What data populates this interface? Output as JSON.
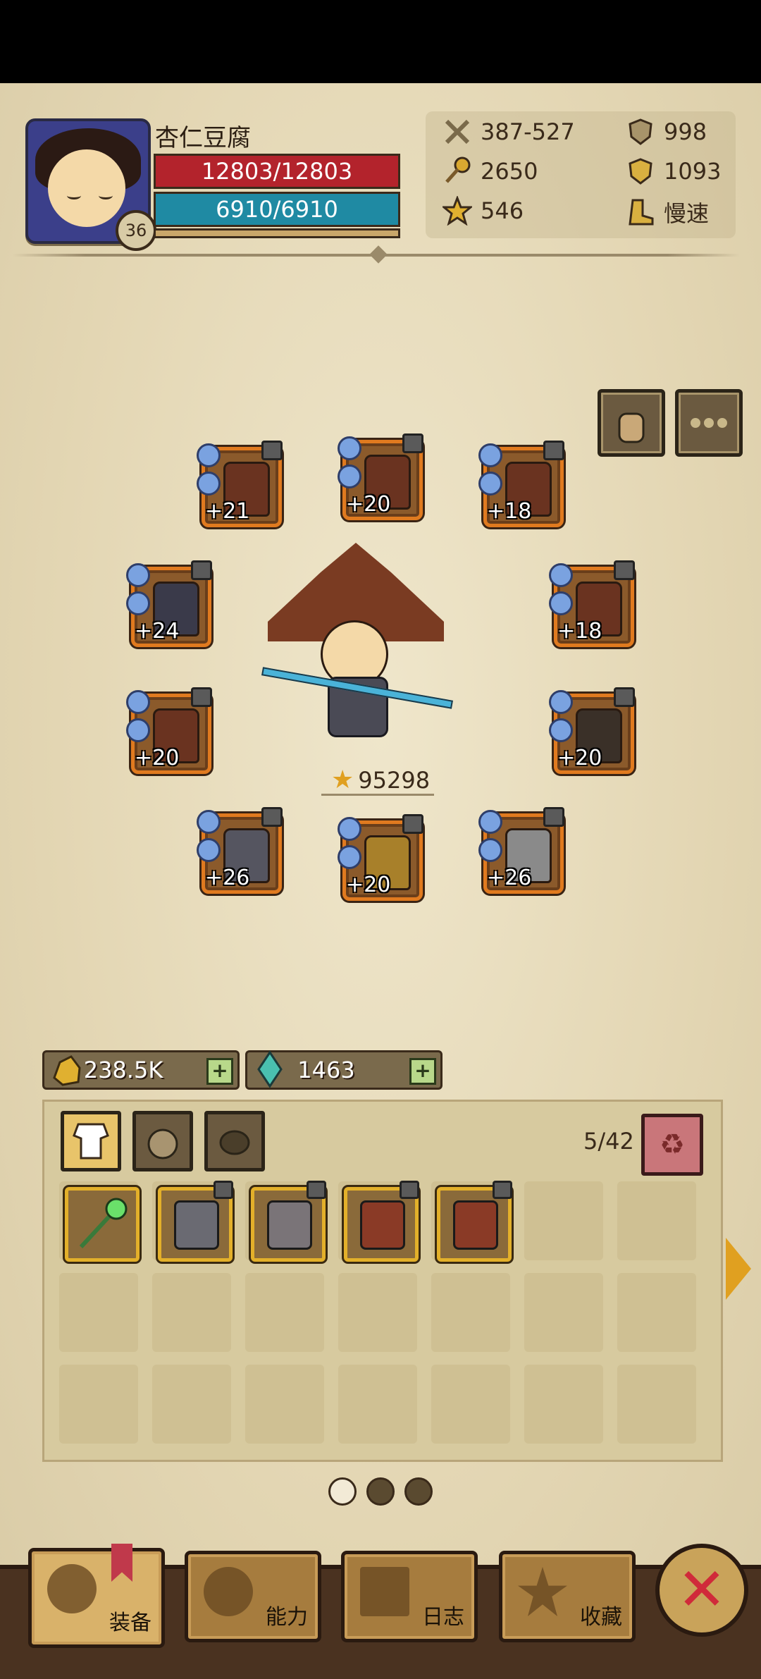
{
  "player": {
    "name": "杏仁豆腐",
    "level": "36",
    "hp": "12803/12803",
    "mp": "6910/6910"
  },
  "stats": {
    "attack": "387-527",
    "defense": "998",
    "magic": "2650",
    "resist": "1093",
    "crit": "546",
    "speed": "慢速",
    "icons": [
      "crossed-swords-icon",
      "shield-icon",
      "magic-staff-icon",
      "crest-shield-icon",
      "star-icon",
      "boot-speed-icon"
    ]
  },
  "equipment": {
    "slots": [
      {
        "plus": "+21"
      },
      {
        "plus": "+20"
      },
      {
        "plus": "+18"
      },
      {
        "plus": "+24"
      },
      {
        "plus": "+18"
      },
      {
        "plus": "+20"
      },
      {
        "plus": "+20"
      },
      {
        "plus": "+26"
      },
      {
        "plus": "+20"
      },
      {
        "plus": "+26"
      }
    ],
    "power": "95298"
  },
  "currency": {
    "gold": "238.5K",
    "gems": "1463",
    "add": "+"
  },
  "inventory": {
    "count": "5/42",
    "items": [
      "green-staff",
      "iron-helmet",
      "chain-armor",
      "leather-cloak",
      "leather-cloak-2"
    ]
  },
  "nav": {
    "equip": "装备",
    "ability": "能力",
    "journal": "日志",
    "collect": "收藏"
  },
  "colors": {
    "hp": "#b3232c",
    "mp": "#1f8aa3",
    "slot_border": "#e07a1f",
    "item_border": "#e3b02a"
  }
}
